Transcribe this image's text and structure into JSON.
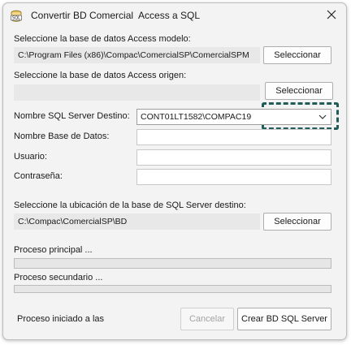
{
  "window": {
    "title": "Convertir BD Comercial  Access a SQL"
  },
  "model_db": {
    "label": "Seleccione la base de datos Access modelo:",
    "path": "C:\\Program Files (x86)\\Compac\\ComercialSP\\ComercialSPM",
    "button": "Seleccionar"
  },
  "origin_db": {
    "label": "Seleccione la base de datos Access origen:",
    "path": "",
    "button": "Seleccionar"
  },
  "server": {
    "label": "Nombre SQL Server Destino:",
    "value": "CONT01LT1582\\COMPAC19"
  },
  "db_name": {
    "label": "Nombre Base de Datos:",
    "value": ""
  },
  "user": {
    "label": "Usuario:",
    "value": ""
  },
  "password": {
    "label": "Contraseña:",
    "value": ""
  },
  "sql_location": {
    "label": "Seleccione la ubicación de la base de SQL Server destino:",
    "path": "C:\\Compac\\ComercialSP\\BD",
    "button": "Seleccionar"
  },
  "progress_main": {
    "label": "Proceso principal ...",
    "value": 0
  },
  "progress_secondary": {
    "label": "Proceso secundario ...",
    "value": 0
  },
  "footer": {
    "status": "Proceso iniciado a las",
    "cancel": "Cancelar",
    "create": "Crear BD SQL Server"
  },
  "icons": {
    "app": "sql-database-icon",
    "close": "close-icon",
    "dropdown": "chevron-down-icon"
  },
  "colors": {
    "highlight": "#1f5c5a",
    "progress_fill": "#06b025"
  }
}
